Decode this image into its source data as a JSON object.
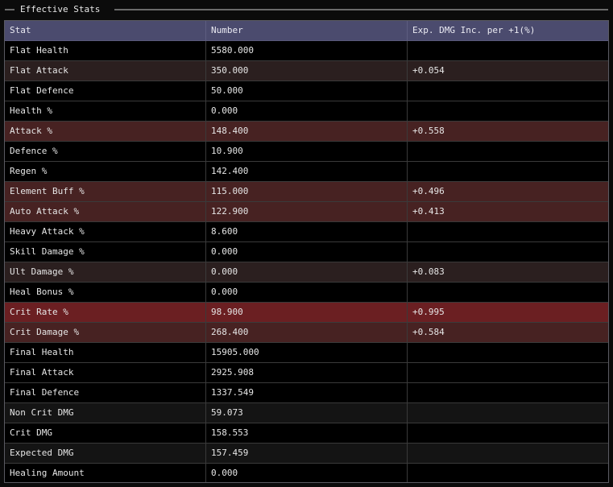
{
  "window": {
    "title": "Effective Stats"
  },
  "table": {
    "columns": [
      "Stat",
      "Number",
      "Exp. DMG Inc. per +1(%)"
    ],
    "rows": [
      {
        "stat": "Flat Health",
        "number": "5580.000",
        "inc": "",
        "tint": "normal"
      },
      {
        "stat": "Flat Attack",
        "number": "350.000",
        "inc": "+0.054",
        "tint": "light"
      },
      {
        "stat": "Flat Defence",
        "number": "50.000",
        "inc": "",
        "tint": "normal"
      },
      {
        "stat": "Health %",
        "number": "0.000",
        "inc": "",
        "tint": "normal"
      },
      {
        "stat": "Attack %",
        "number": "148.400",
        "inc": "+0.558",
        "tint": "mid"
      },
      {
        "stat": "Defence %",
        "number": "10.900",
        "inc": "",
        "tint": "normal"
      },
      {
        "stat": "Regen %",
        "number": "142.400",
        "inc": "",
        "tint": "normal"
      },
      {
        "stat": "Element Buff %",
        "number": "115.000",
        "inc": "+0.496",
        "tint": "mid"
      },
      {
        "stat": "Auto Attack %",
        "number": "122.900",
        "inc": "+0.413",
        "tint": "mid"
      },
      {
        "stat": "Heavy Attack %",
        "number": "8.600",
        "inc": "",
        "tint": "normal"
      },
      {
        "stat": "Skill Damage %",
        "number": "0.000",
        "inc": "",
        "tint": "normal"
      },
      {
        "stat": "Ult Damage %",
        "number": "0.000",
        "inc": "+0.083",
        "tint": "light"
      },
      {
        "stat": "Heal Bonus %",
        "number": "0.000",
        "inc": "",
        "tint": "normal"
      },
      {
        "stat": "Crit Rate %",
        "number": "98.900",
        "inc": "+0.995",
        "tint": "strong"
      },
      {
        "stat": "Crit Damage %",
        "number": "268.400",
        "inc": "+0.584",
        "tint": "mid"
      },
      {
        "stat": "Final Health",
        "number": "15905.000",
        "inc": "",
        "tint": "normal"
      },
      {
        "stat": "Final Attack",
        "number": "2925.908",
        "inc": "",
        "tint": "normal"
      },
      {
        "stat": "Final Defence",
        "number": "1337.549",
        "inc": "",
        "tint": "normal"
      },
      {
        "stat": "Non Crit DMG",
        "number": "59.073",
        "inc": "",
        "tint": "alt"
      },
      {
        "stat": "Crit DMG",
        "number": "158.553",
        "inc": "",
        "tint": "normal"
      },
      {
        "stat": "Expected DMG",
        "number": "157.459",
        "inc": "",
        "tint": "alt"
      },
      {
        "stat": "Healing Amount",
        "number": "0.000",
        "inc": "",
        "tint": "normal"
      }
    ]
  },
  "colors": {
    "header_bg": "#4b4b6e",
    "row_bg": "#000000",
    "tint_light": "#2b1f1f",
    "tint_mid": "#472222",
    "tint_strong": "#6b1f22"
  }
}
